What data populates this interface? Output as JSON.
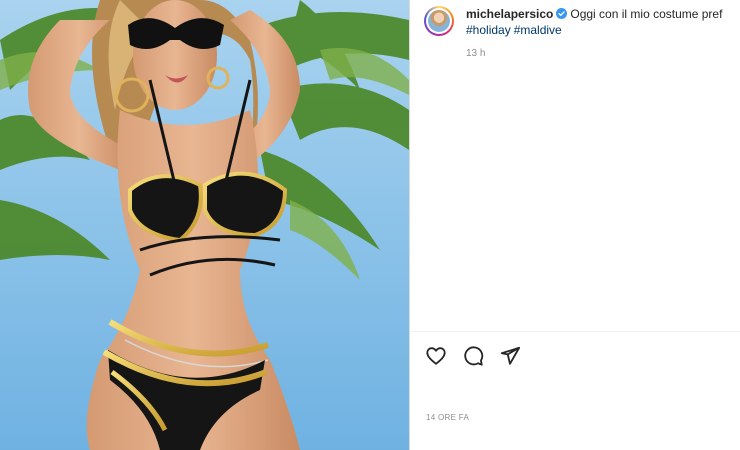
{
  "post": {
    "username": "michelapersico",
    "caption_text": "Oggi con il mio costume pref",
    "hashtags": [
      "#holiday",
      "#maldive"
    ],
    "time_ago": "13 h",
    "date_label": "14 ORE FA"
  },
  "icons": {
    "like": "heart-icon",
    "comment": "comment-icon",
    "share": "paper-plane-icon",
    "verified": "verified-badge-icon"
  },
  "colors": {
    "link": "#00376b",
    "verified": "#3897f0",
    "meta_text": "#8e8e8e",
    "text": "#262626",
    "sky": "#8fc3e6"
  }
}
